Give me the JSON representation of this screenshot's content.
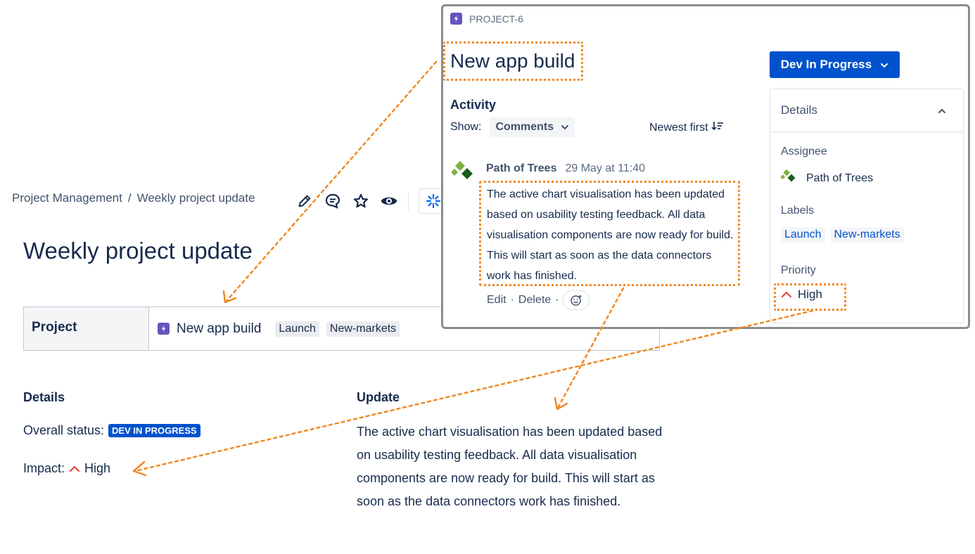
{
  "page": {
    "breadcrumb": [
      "Project Management",
      "/",
      "Weekly project update"
    ],
    "title": "Weekly project update",
    "project_table": {
      "header": "Project",
      "name": "New app build",
      "labels": [
        "Launch",
        "New-markets"
      ]
    },
    "details": {
      "heading": "Details",
      "overall_status_label": "Overall status:",
      "overall_status_value": "DEV IN PROGRESS",
      "impact_label": "Impact:",
      "impact_value": "High"
    },
    "update": {
      "heading": "Update",
      "text": "The active chart visualisation has been updated based on usability testing feedback. All data visualisation components are now ready for build. This will start as soon as the data connectors work has finished."
    },
    "toolbar_icons": [
      "edit-icon",
      "comment-icon",
      "star-icon",
      "watch-icon",
      "loading-icon"
    ]
  },
  "popup": {
    "key": "PROJECT-6",
    "title": "New app build",
    "activity": {
      "heading": "Activity",
      "show_label": "Show:",
      "filter": "Comments",
      "sort": "Newest first",
      "comment": {
        "author": "Path of Trees",
        "date": "29 May at 11:40",
        "text": "The active chart visualisation has been updated based on usability testing feedback. All data visualisation components are now ready for build. This will start as soon as the data connectors work has finished.",
        "edit": "Edit",
        "delete": "Delete",
        "sep": "·"
      }
    },
    "status_button": "Dev In Progress",
    "details": {
      "heading": "Details",
      "assignee_label": "Assignee",
      "assignee": "Path of Trees",
      "labels_label": "Labels",
      "labels": [
        "Launch",
        "New-markets"
      ],
      "priority_label": "Priority",
      "priority": "High"
    }
  },
  "colors": {
    "brand_blue": "#0052cc",
    "epic_purple": "#6554c0",
    "highlight_orange": "#f08a24",
    "priority_red": "#e5493a",
    "text": "#172b4d"
  }
}
